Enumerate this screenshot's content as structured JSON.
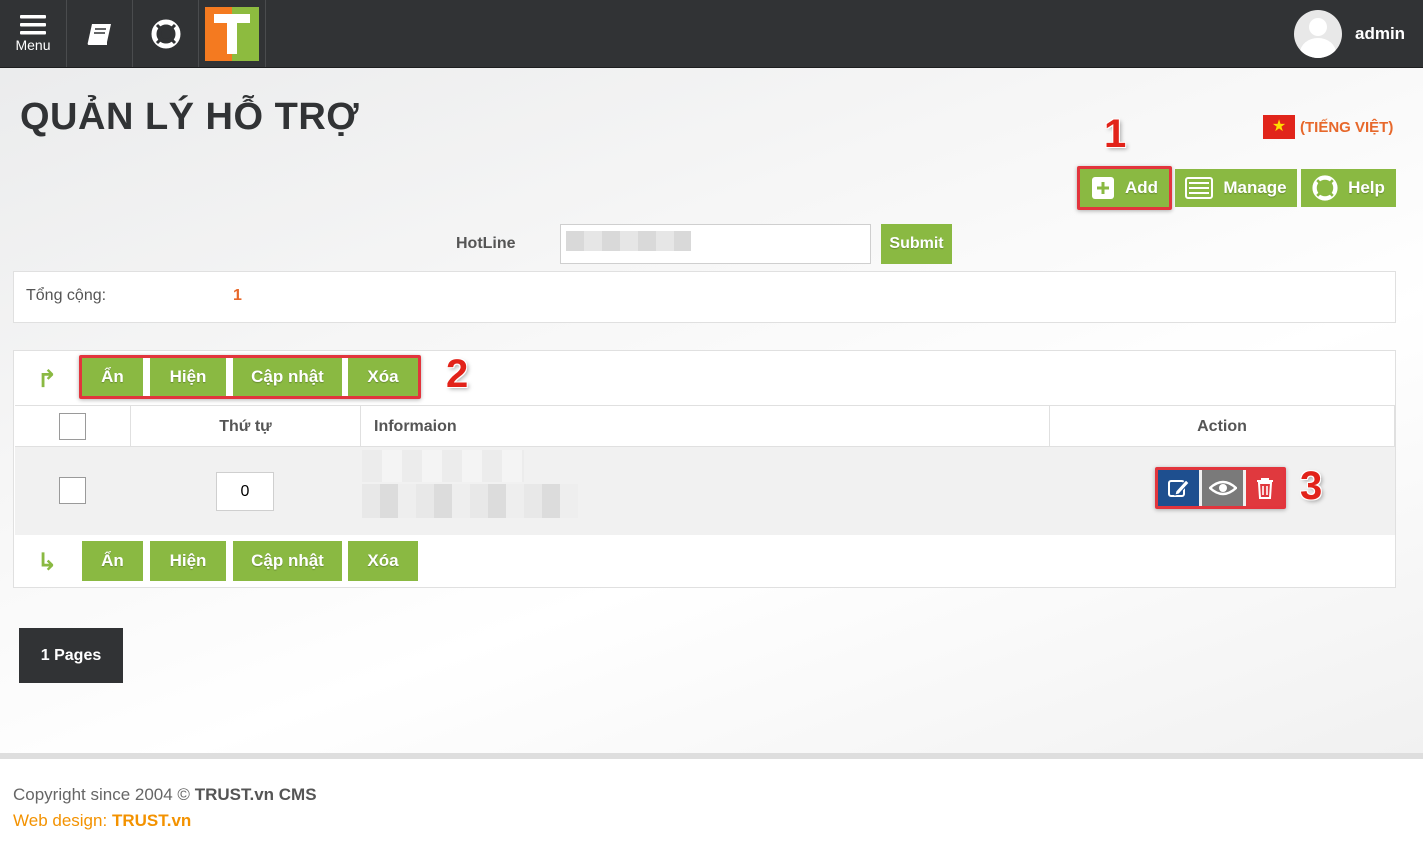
{
  "topbar": {
    "menu_label": "Menu",
    "user_name": "admin"
  },
  "page": {
    "title": "QUẢN LÝ HỖ TRỢ",
    "language": "(TIẾNG VIỆT)"
  },
  "annotations": [
    "1",
    "2",
    "3"
  ],
  "toolbar": {
    "add_label": "Add",
    "manage_label": "Manage",
    "help_label": "Help"
  },
  "hotline": {
    "label": "HotLine",
    "value": "",
    "submit_label": "Submit"
  },
  "summary": {
    "total_label": "Tổng cộng:",
    "total_value": "1"
  },
  "bulk_actions": {
    "hide_label": "Ẩn",
    "show_label": "Hiện",
    "update_label": "Cập nhật",
    "delete_label": "Xóa"
  },
  "table": {
    "columns": [
      "Thứ tự",
      "Informaion",
      "Action"
    ],
    "rows": [
      {
        "order": "0"
      }
    ]
  },
  "pagination": {
    "label": "1 Pages"
  },
  "footer": {
    "copyright_prefix": "Copyright since 2004 ©",
    "copyright_brand": "TRUST.vn CMS",
    "webdesign_prefix": "Web design:",
    "webdesign_brand": "TRUST.vn"
  },
  "colors": {
    "topbar": "#313335",
    "button_green": "#8ab942",
    "accent_orange": "#e7682b",
    "edit_blue": "#1e4f8f",
    "view_gray": "#7a7a7a",
    "delete_red": "#e0393e",
    "annotation_red": "#e2231a"
  },
  "icons": [
    "menu-icon",
    "book-icon",
    "lifebuoy-icon",
    "trust-logo",
    "user-avatar-icon",
    "vietnam-flag",
    "plus-icon",
    "list-icon",
    "help-lifebuoy-icon",
    "corner-arrow-icon",
    "edit-icon",
    "eye-icon",
    "trash-icon"
  ]
}
